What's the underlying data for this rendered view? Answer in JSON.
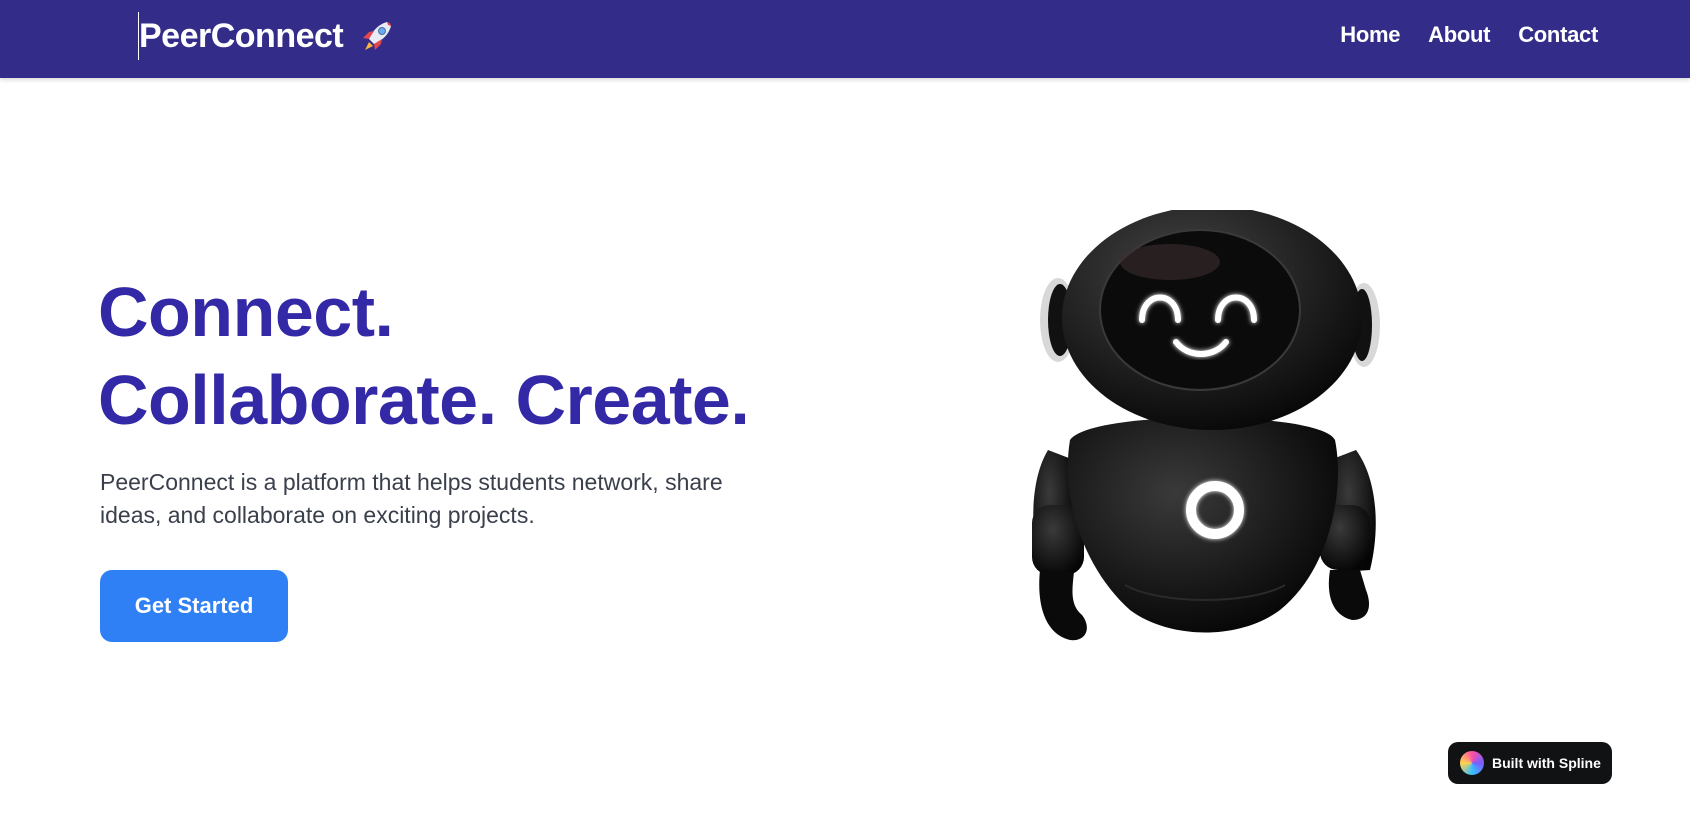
{
  "navbar": {
    "brand": "PeerConnect",
    "brand_icon": "rocket-icon",
    "links": [
      "Home",
      "About",
      "Contact"
    ]
  },
  "hero": {
    "title_line1": "Connect.",
    "title_line2": "Collaborate. Create.",
    "description": "PeerConnect is a platform that helps students network, share ideas, and collaborate on exciting projects.",
    "cta_label": "Get Started"
  },
  "badge": {
    "label": "Built with Spline"
  },
  "colors": {
    "nav_bg": "#332d89",
    "title": "#3328a6",
    "cta": "#2f7ff5",
    "badge_bg": "#111214"
  }
}
